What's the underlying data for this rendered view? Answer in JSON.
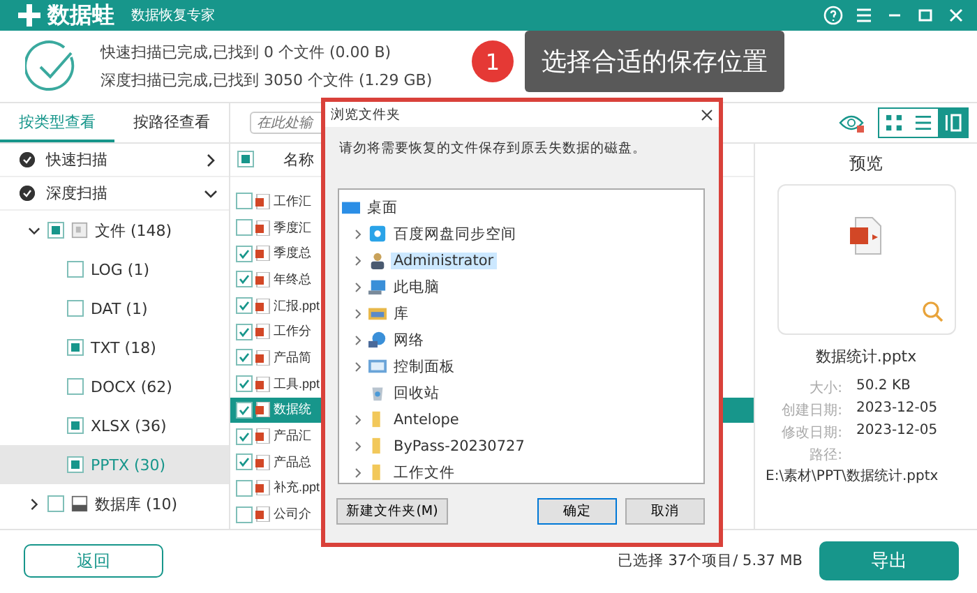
{
  "app": {
    "name": "数据蛙",
    "subtitle": "数据恢复专家"
  },
  "scan_status": [
    "快速扫描已完成,已找到 0 个文件 (0.00  B)",
    "深度扫描已完成,已找到 3050 个文件 (1.29 GB)"
  ],
  "tooltip": {
    "step": "1",
    "text": "选择合适的保存位置"
  },
  "sidebar": {
    "tabs": [
      {
        "label": "按类型查看",
        "selected": true
      },
      {
        "label": "按路径查看",
        "selected": false
      }
    ],
    "scans": [
      {
        "label": "快速扫描",
        "expanded": false
      },
      {
        "label": "深度扫描",
        "expanded": true
      }
    ],
    "tree": [
      {
        "label": "文件 (148)",
        "kind": "files",
        "expanded": true,
        "checked": true,
        "selected": false,
        "children": [
          {
            "label": "LOG (1)",
            "checked": false,
            "selected": false
          },
          {
            "label": "DAT (1)",
            "checked": false,
            "selected": false
          },
          {
            "label": "TXT (18)",
            "checked": true,
            "selected": false
          },
          {
            "label": "DOCX (62)",
            "checked": false,
            "selected": false
          },
          {
            "label": "XLSX (36)",
            "checked": true,
            "selected": false
          },
          {
            "label": "PPTX (30)",
            "checked": true,
            "selected": true
          }
        ]
      },
      {
        "label": "数据库 (10)",
        "kind": "database",
        "expanded": false,
        "checked": false,
        "selected": false
      }
    ]
  },
  "file_list": {
    "search": {
      "placeholder": "在此处输"
    },
    "header": {
      "label": "名称",
      "checked": true
    },
    "rows": [
      {
        "name": "工作汇",
        "checked": false,
        "selected": false
      },
      {
        "name": "季度汇",
        "checked": false,
        "selected": false
      },
      {
        "name": "季度总",
        "checked": true,
        "selected": false
      },
      {
        "name": "年终总",
        "checked": true,
        "selected": false
      },
      {
        "name": "汇报.ppt",
        "checked": true,
        "selected": false
      },
      {
        "name": "工作分",
        "checked": true,
        "selected": false
      },
      {
        "name": "产品简",
        "checked": true,
        "selected": false
      },
      {
        "name": "工具.ppt",
        "checked": true,
        "selected": false
      },
      {
        "name": "数据统",
        "checked": true,
        "selected": true
      },
      {
        "name": "产品汇",
        "checked": true,
        "selected": false
      },
      {
        "name": "产品总",
        "checked": true,
        "selected": false
      },
      {
        "name": "补充.ppt",
        "checked": false,
        "selected": false
      },
      {
        "name": "公司介",
        "checked": false,
        "selected": false
      }
    ]
  },
  "view_modes": [
    {
      "kind": "grid",
      "selected": false
    },
    {
      "kind": "list",
      "selected": false
    },
    {
      "kind": "detail",
      "selected": true
    }
  ],
  "preview": {
    "title": "预览",
    "file_name": "数据统计.pptx",
    "details": [
      {
        "label": "大小:",
        "value": "50.2 KB"
      },
      {
        "label": "创建日期:",
        "value": "2023-12-05"
      },
      {
        "label": "修改日期:",
        "value": "2023-12-05"
      }
    ],
    "path_label": "路径:",
    "path": "E:\\素材\\PPT\\数据统计.pptx"
  },
  "footer": {
    "back": "返回",
    "selection": "已选择 37个项目/ 5.37 MB",
    "export": "导出"
  },
  "dialog": {
    "title": "浏览文件夹",
    "message": "请勿将需要恢复的文件保存到原丢失数据的磁盘。",
    "root": {
      "label": "桌面",
      "kind": "desktop",
      "selected": false
    },
    "folders": [
      {
        "label": "百度网盘同步空间",
        "kind": "cloud",
        "expandable": true,
        "selected": false
      },
      {
        "label": "Administrator",
        "kind": "user",
        "expandable": true,
        "selected": true
      },
      {
        "label": "此电脑",
        "kind": "computer",
        "expandable": true,
        "selected": false
      },
      {
        "label": "库",
        "kind": "library",
        "expandable": true,
        "selected": false
      },
      {
        "label": "网络",
        "kind": "network",
        "expandable": true,
        "selected": false
      },
      {
        "label": "控制面板",
        "kind": "control-panel",
        "expandable": true,
        "selected": false
      },
      {
        "label": "回收站",
        "kind": "recycle-bin",
        "expandable": false,
        "selected": false
      },
      {
        "label": "Antelope",
        "kind": "folder",
        "expandable": true,
        "selected": false
      },
      {
        "label": "ByPass-20230727",
        "kind": "folder",
        "expandable": true,
        "selected": false
      },
      {
        "label": "工作文件",
        "kind": "folder",
        "expandable": true,
        "selected": false
      }
    ],
    "buttons": [
      {
        "label": "新建文件夹(M)",
        "default": false
      },
      {
        "label": "确定",
        "default": true
      },
      {
        "label": "取消",
        "default": false
      }
    ]
  }
}
